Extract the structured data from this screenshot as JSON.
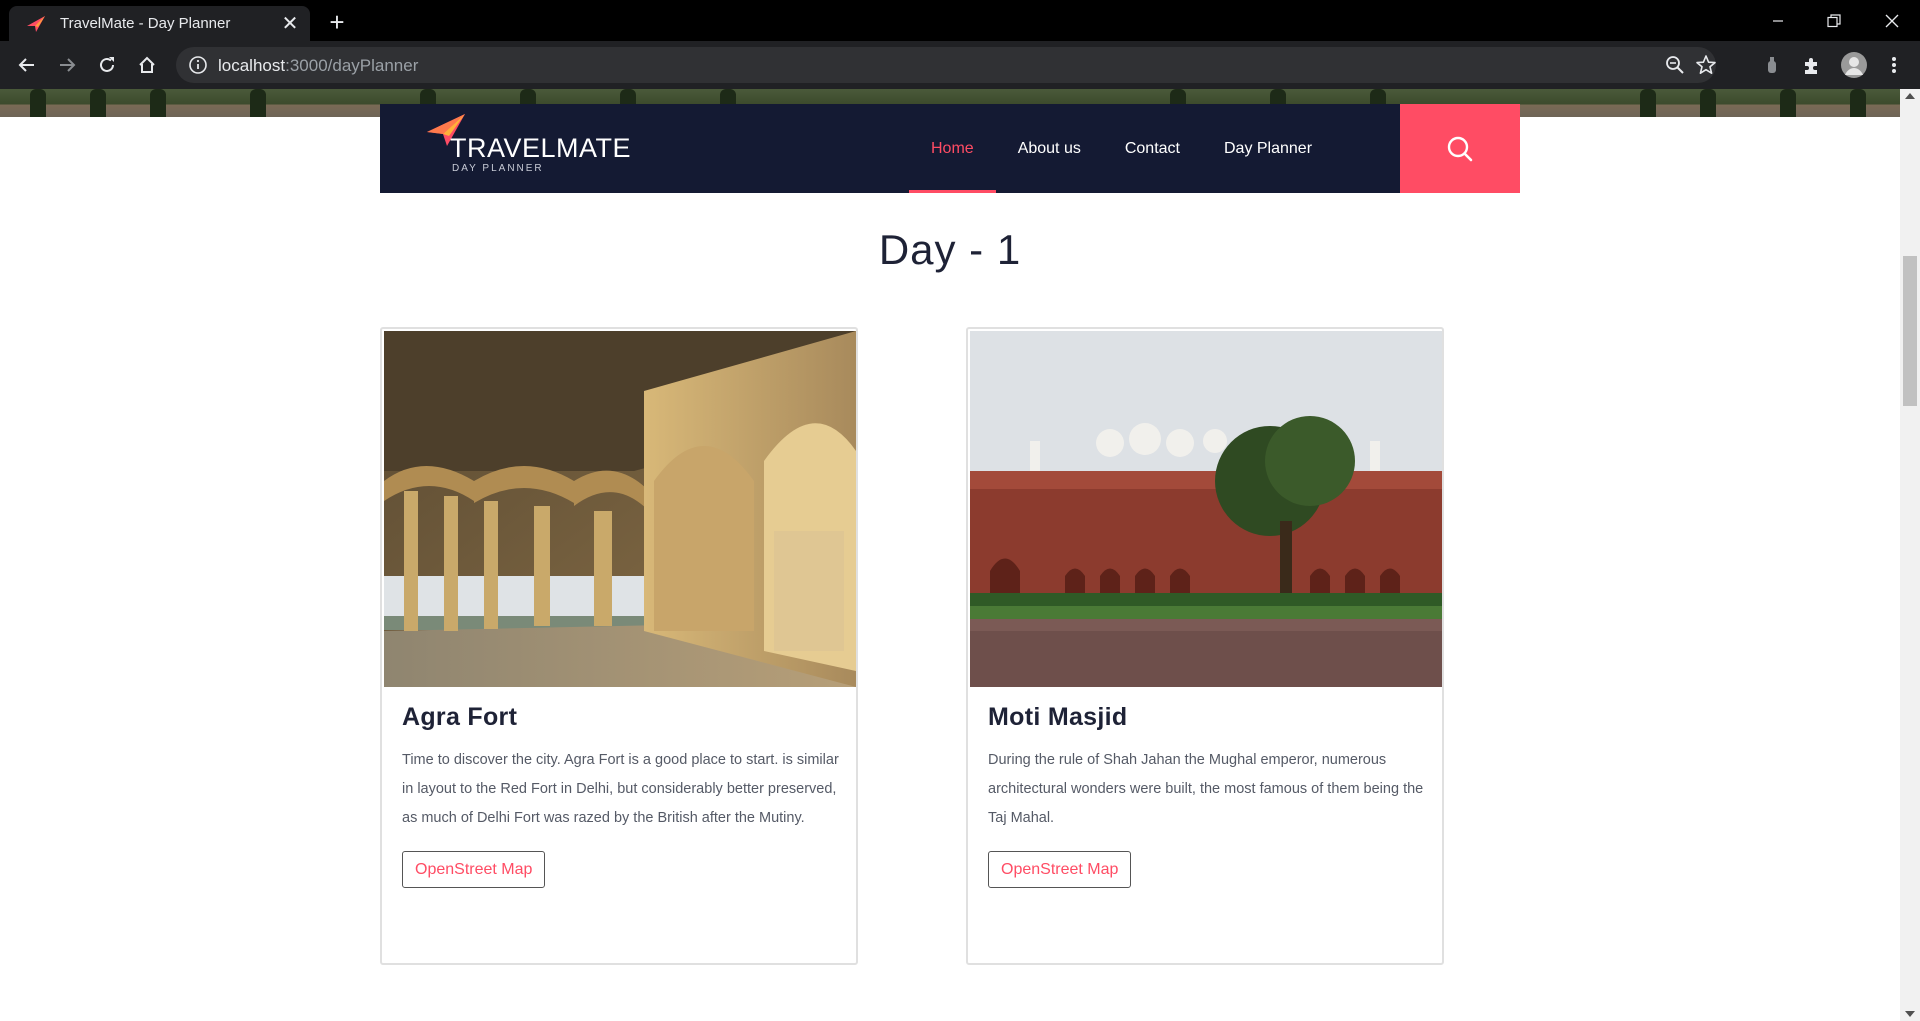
{
  "browser": {
    "tab_title": "TravelMate - Day Planner",
    "url_host": "localhost",
    "url_path": ":3000/dayPlanner",
    "new_tab_symbol": "+",
    "close_symbol": "✕"
  },
  "site": {
    "logo_title": "TRAVELMATE",
    "logo_subtitle": "DAY PLANNER",
    "nav": [
      {
        "label": "Home",
        "active": true
      },
      {
        "label": "About us",
        "active": false
      },
      {
        "label": "Contact",
        "active": false
      },
      {
        "label": "Day Planner",
        "active": false
      }
    ],
    "accent_color": "#ff4c64",
    "navbar_color": "#141a33"
  },
  "planner": {
    "day_heading": "Day - 1",
    "cards": [
      {
        "title": "Agra Fort",
        "description": "Time to discover the city. Agra Fort is a good place to start. is similar in layout to the Red Fort in Delhi, but considerably better preserved, as much of Delhi Fort was razed by the British after the Mutiny.",
        "button_label": "OpenStreet Map"
      },
      {
        "title": "Moti Masjid",
        "description": "During the rule of Shah Jahan the Mughal emperor, numerous architectural wonders were built, the most famous of them being the Taj Mahal.",
        "button_label": "OpenStreet Map"
      }
    ]
  },
  "icons": {
    "back": "arrow-left-icon",
    "forward": "arrow-right-icon",
    "reload": "reload-icon",
    "home": "home-icon",
    "site_info": "info-icon",
    "zoom": "zoom-icon",
    "bookmark": "star-icon",
    "search": "search-icon"
  }
}
